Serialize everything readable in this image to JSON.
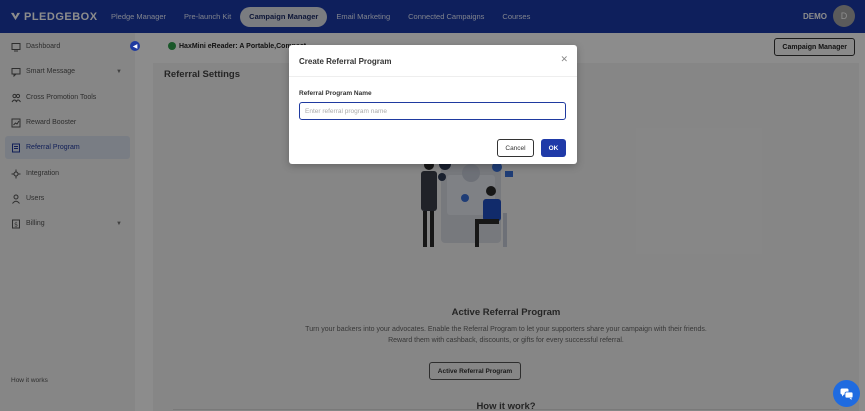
{
  "app": {
    "logo_text": "PLEDGEBOX",
    "user_label": "DEMO",
    "avatar_initial": "D"
  },
  "nav": {
    "links": [
      {
        "label": "Pledge Manager"
      },
      {
        "label": "Pre-launch Kit"
      },
      {
        "label": "Campaign Manager"
      },
      {
        "label": "Email Marketing"
      },
      {
        "label": "Connected Campaigns"
      },
      {
        "label": "Courses"
      }
    ],
    "active": "Campaign Manager"
  },
  "sidebar": {
    "items": [
      {
        "label": "Dashboard",
        "icon": "dashboard-icon"
      },
      {
        "label": "Smart Message",
        "icon": "message-icon"
      },
      {
        "label": "Cross Promotion Tools",
        "icon": "people-icon"
      },
      {
        "label": "Reward Booster",
        "icon": "chart-icon"
      },
      {
        "label": "Referral Program",
        "icon": "referral-icon"
      },
      {
        "label": "Integration",
        "icon": "integration-icon"
      },
      {
        "label": "Users",
        "icon": "user-icon"
      },
      {
        "label": "Billing",
        "icon": "billing-icon"
      }
    ],
    "active": "Referral Program",
    "footer": "How it works"
  },
  "main": {
    "breadcrumb": "HaxMini eReader: A Portable,Compact...",
    "campaign_manager_button": "Campaign Manager",
    "page_title": "Referral Settings",
    "section_title": "Active Referral Program",
    "description_line1": "Turn your backers into your advocates. Enable the Referral Program to let your supporters share your campaign with their friends.",
    "description_line2": "Reward them with cashback, discounts, or gifts for every successful referral.",
    "activate_button": "Active Referral Program",
    "how_title": "How it work?"
  },
  "modal": {
    "title": "Create Referral Program",
    "field_label": "Referral Program Name",
    "field_placeholder": "Enter referral program name",
    "field_value": "",
    "cancel_label": "Cancel",
    "ok_label": "OK"
  },
  "colors": {
    "brand": "#1a3aa8",
    "accent": "#1f3aa0",
    "overlay": "rgba(0,0,0,0.45)"
  }
}
